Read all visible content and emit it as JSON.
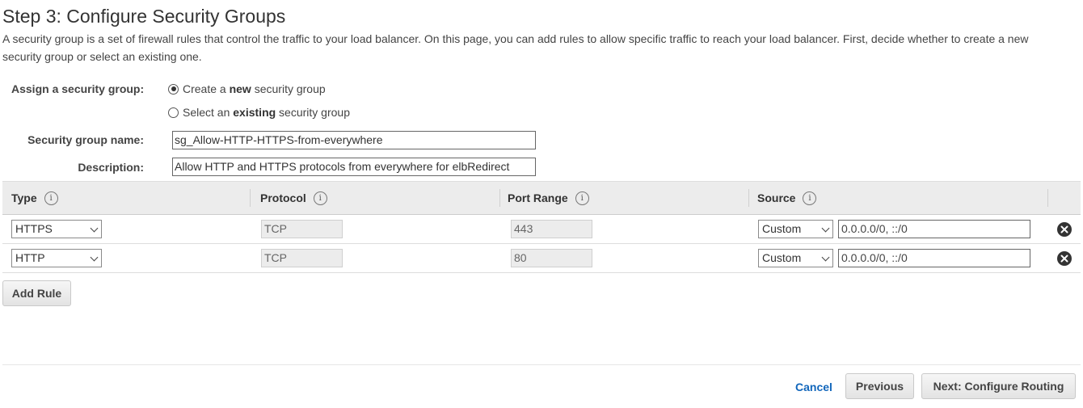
{
  "page": {
    "title": "Step 3: Configure Security Groups",
    "intro": "A security group is a set of firewall rules that control the traffic to your load balancer. On this page, you can add rules to allow specific traffic to reach your load balancer. First, decide whether to create a new security group or select an existing one."
  },
  "assign": {
    "label": "Assign a security group:",
    "option_new_prefix": "Create a ",
    "option_new_bold": "new",
    "option_new_suffix": " security group",
    "option_existing_prefix": "Select an ",
    "option_existing_bold": "existing",
    "option_existing_suffix": " security group",
    "selected": "new"
  },
  "fields": {
    "name_label": "Security group name:",
    "name_value": "sg_Allow-HTTP-HTTPS-from-everywhere",
    "description_label": "Description:",
    "description_value": "Allow HTTP and HTTPS protocols from everywhere for elbRedirect"
  },
  "table": {
    "headers": [
      "Type",
      "Protocol",
      "Port Range",
      "Source"
    ],
    "rows": [
      {
        "type": "HTTPS",
        "protocol": "TCP",
        "port": "443",
        "source_type": "Custom",
        "source": "0.0.0.0/0, ::/0"
      },
      {
        "type": "HTTP",
        "protocol": "TCP",
        "port": "80",
        "source_type": "Custom",
        "source": "0.0.0.0/0, ::/0"
      }
    ]
  },
  "actions": {
    "add_rule": "Add Rule",
    "cancel": "Cancel",
    "previous": "Previous",
    "next": "Next: Configure Routing"
  },
  "icons": {
    "info": "info-icon",
    "remove": "remove-circle-icon"
  }
}
